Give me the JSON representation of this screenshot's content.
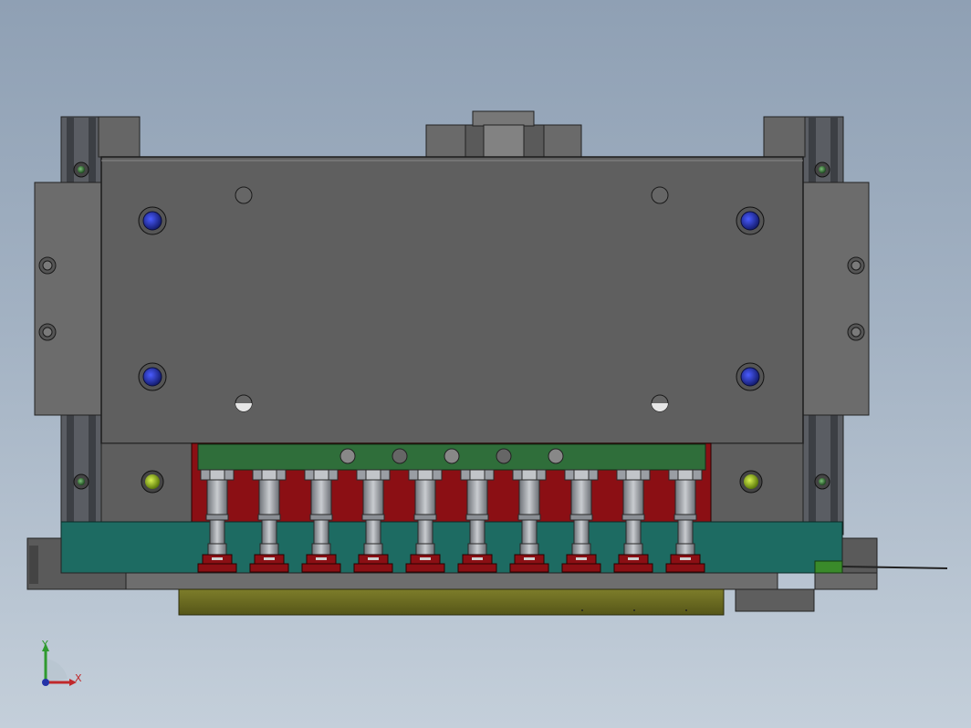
{
  "triad": {
    "x_label": "X",
    "y_label": "Y",
    "x_color": "#c0282b",
    "y_color": "#2f9a2f",
    "z_color": "#2433a8"
  },
  "colors": {
    "background_top": "#8fa0b4",
    "background_bottom": "#c4cfda",
    "main_plate": "#5f5f5f",
    "side_block": "#6a6a6a",
    "rail": "#4f5258",
    "manifold": "#8b0f14",
    "green_bar": "#2f6e3a",
    "teal_plate": "#1d6b62",
    "base_plate": "#6b6b23",
    "blue_screw": "#1f2a9c",
    "yellow_screw": "#8fb010"
  },
  "assembly": {
    "nozzle_count": 10
  }
}
